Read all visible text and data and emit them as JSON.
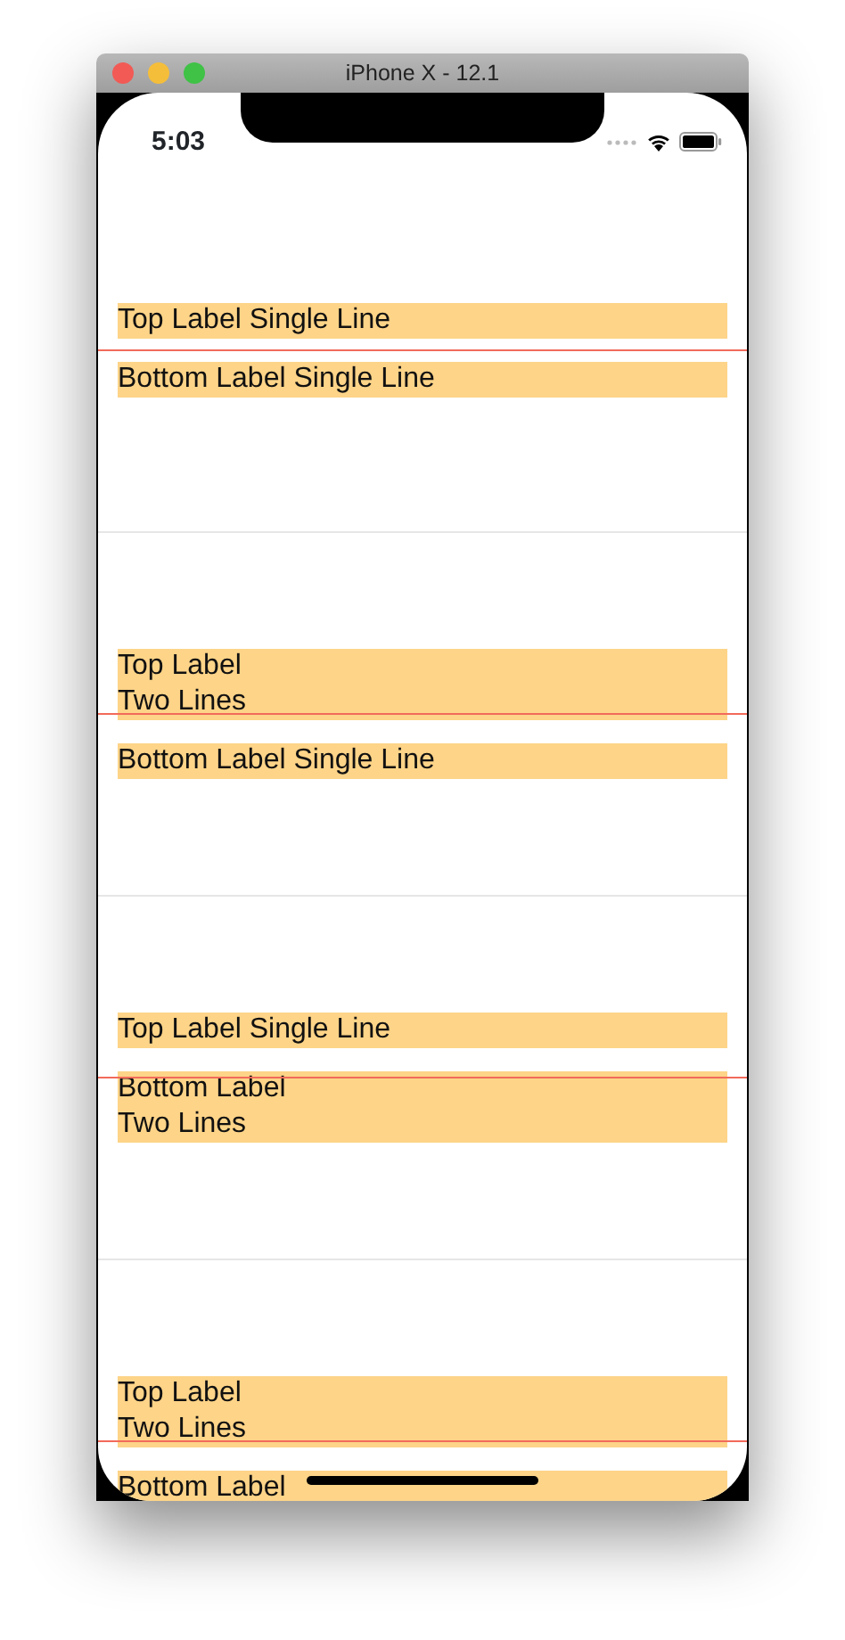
{
  "window": {
    "title": "iPhone X - 12.1"
  },
  "status_bar": {
    "time": "5:03"
  },
  "cells": [
    {
      "top_label": "Top Label Single Line",
      "bottom_label": "Bottom Label Single Line"
    },
    {
      "top_label": "Top Label\nTwo Lines",
      "bottom_label": "Bottom Label Single Line"
    },
    {
      "top_label": "Top Label Single Line",
      "bottom_label": "Bottom Label\nTwo Lines"
    },
    {
      "top_label": "Top Label\nTwo Lines",
      "bottom_label": "Bottom Label"
    }
  ]
}
